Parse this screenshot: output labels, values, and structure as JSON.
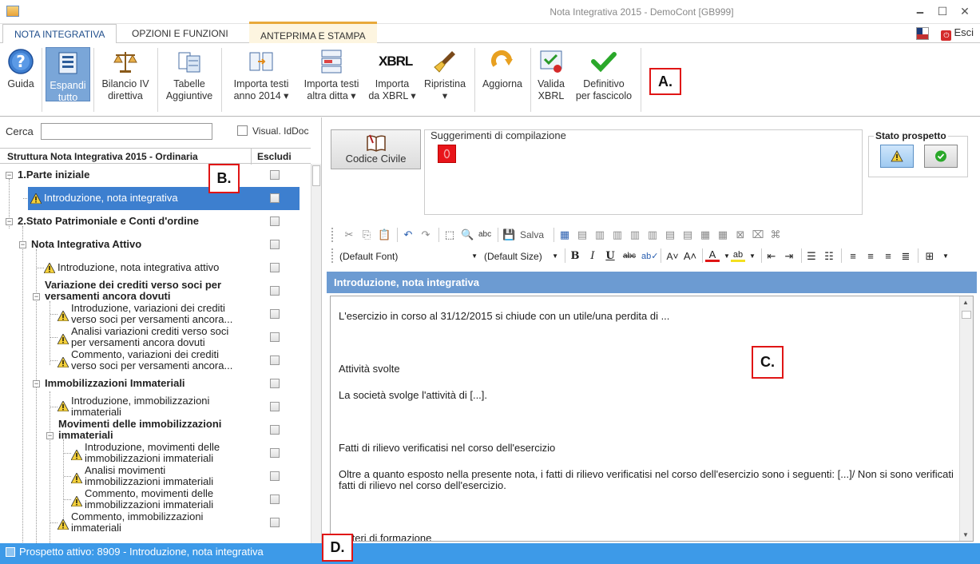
{
  "window": {
    "title": "Nota Integrativa 2015 - DemoCont [GB999]",
    "minimize_glyph": "🗕",
    "maximize_glyph": "☐",
    "close_glyph": "✕"
  },
  "tabs": [
    {
      "label": "NOTA INTEGRATIVA"
    },
    {
      "label": "OPZIONI E FUNZIONI"
    },
    {
      "label": "ANTEPRIMA E STAMPA"
    }
  ],
  "esci_label": "Esci",
  "ribbon": {
    "guida": "Guida",
    "espandi_1": "Espandi",
    "espandi_2": "tutto",
    "bilancio_1": "Bilancio IV",
    "bilancio_2": "direttiva",
    "tabelle_1": "Tabelle",
    "tabelle_2": "Aggiuntive",
    "importa_anno_1": "Importa testi",
    "importa_anno_2": "anno 2014 ▾",
    "importa_ditta_1": "Importa testi",
    "importa_ditta_2": "altra ditta ▾",
    "importa_xbrl_1": "Importa",
    "importa_xbrl_2": "da XBRL ▾",
    "xbrl_logo": "XBRL",
    "ripristina_1": "Ripristina",
    "ripristina_2": "▾",
    "aggiorna": "Aggiorna",
    "valida_1": "Valida",
    "valida_2": "XBRL",
    "definitivo_1": "Definitivo",
    "definitivo_2": "per fascicolo"
  },
  "left": {
    "search_label": "Cerca",
    "search_value": "",
    "visual_label": "Visual. IdDoc",
    "header_struttura": "Struttura Nota Integrativa 2015 - Ordinaria",
    "header_escludi": "Escludi"
  },
  "tree": [
    {
      "lines": [
        "1.Parte iniziale"
      ]
    },
    {
      "lines": [
        "Introduzione, nota integrativa"
      ]
    },
    {
      "lines": [
        "2.Stato Patrimoniale e Conti d'ordine"
      ]
    },
    {
      "lines": [
        "Nota Integrativa Attivo"
      ]
    },
    {
      "lines": [
        "Introduzione, nota integrativa attivo"
      ]
    },
    {
      "lines": [
        "Variazione dei crediti verso soci per",
        "versamenti ancora dovuti"
      ]
    },
    {
      "lines": [
        "Introduzione, variazioni dei crediti",
        "verso soci per versamenti ancora..."
      ]
    },
    {
      "lines": [
        "Analisi variazioni crediti verso soci",
        "per versamenti ancora dovuti"
      ]
    },
    {
      "lines": [
        "Commento, variazioni dei crediti",
        "verso soci per versamenti ancora..."
      ]
    },
    {
      "lines": [
        "Immobilizzazioni Immateriali"
      ]
    },
    {
      "lines": [
        "Introduzione, immobilizzazioni",
        "immateriali"
      ]
    },
    {
      "lines": [
        "Movimenti delle immobilizzazioni",
        "immateriali"
      ]
    },
    {
      "lines": [
        "Introduzione, movimenti delle",
        "immobilizzazioni immateriali"
      ]
    },
    {
      "lines": [
        "Analisi movimenti",
        "immobilizzazioni immateriali"
      ]
    },
    {
      "lines": [
        "Commento, movimenti delle",
        "immobilizzazioni immateriali"
      ]
    },
    {
      "lines": [
        "Commento, immobilizzazioni",
        "immateriali"
      ]
    }
  ],
  "right": {
    "codice_civile": "Codice Civile",
    "suggerimenti": "Suggerimenti di compilazione",
    "stato_prospetto": "Stato prospetto",
    "salva": "Salva",
    "font_name": "(Default Font)",
    "font_size": "(Default Size)",
    "section_title": "Introduzione, nota integrativa",
    "editor": [
      "L'esercizio in corso al 31/12/2015 si chiude con un utile/una perdita di ...",
      "Attività svolte",
      "La società svolge l'attività di [...].",
      "Fatti di rilievo verificatisi nel corso dell'esercizio",
      "Oltre a quanto esposto nella presente nota, i fatti di rilievo verificatisi nel corso dell'esercizio sono i seguenti: [...]/ Non si sono verificati fatti di rilievo nel corso dell'esercizio.",
      "Criteri di formazione"
    ]
  },
  "status": {
    "text": "Prospetto attivo: 8909 - Introduzione, nota integrativa"
  },
  "callouts": {
    "a": "A.",
    "b": "B.",
    "c": "C.",
    "d": "D."
  },
  "colors": {
    "accent_blue": "#3d7fcf",
    "section_bar": "#6c9bd2",
    "status_bar": "#3d9ae8",
    "callout_red": "#e01515"
  }
}
